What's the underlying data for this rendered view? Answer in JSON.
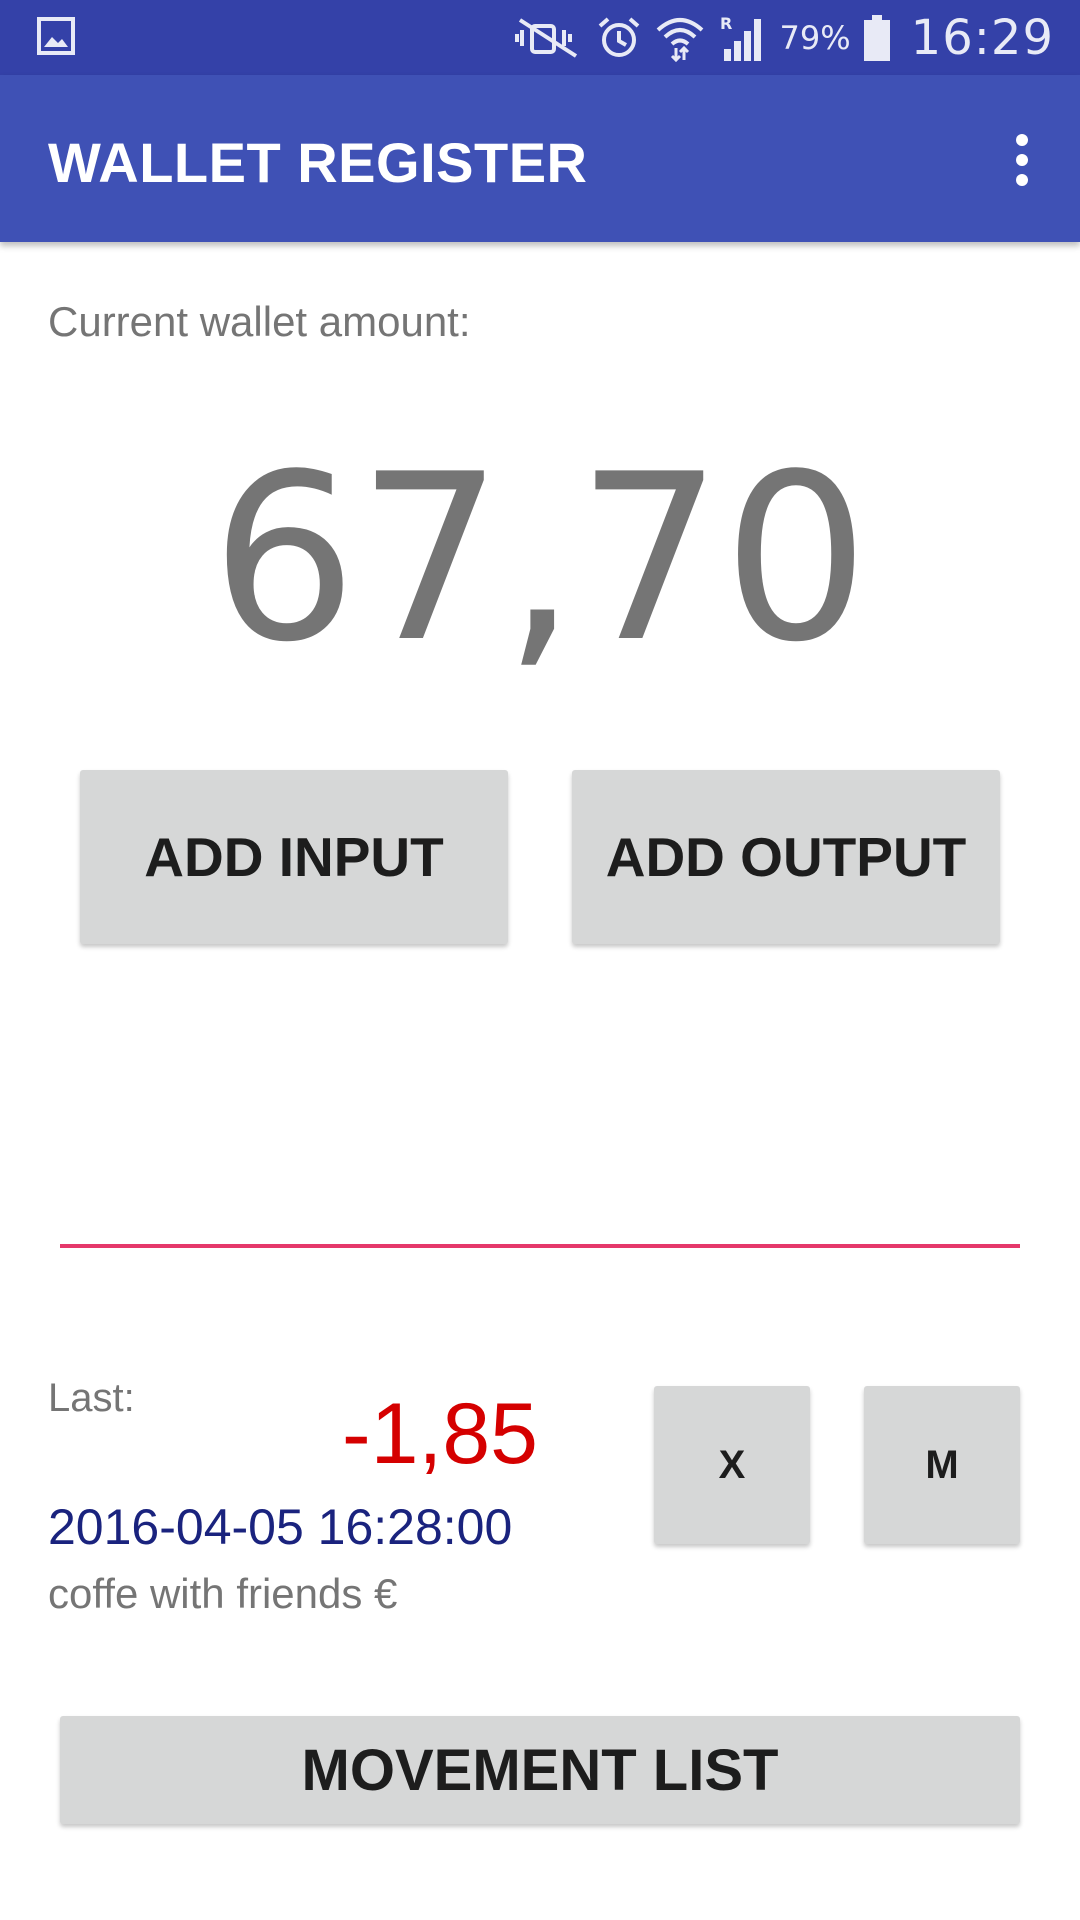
{
  "status_bar": {
    "battery_percent": "79%",
    "time": "16:29",
    "icons": [
      "gallery-icon",
      "mute-vibrate-icon",
      "alarm-icon",
      "wifi-icon",
      "signal-roaming-icon",
      "battery-icon"
    ]
  },
  "app_bar": {
    "title": "WALLET REGISTER",
    "overflow_icon": "more-vert-icon"
  },
  "wallet": {
    "label": "Current wallet amount:",
    "amount": "67,70"
  },
  "actions": {
    "add_input_label": "ADD INPUT",
    "add_output_label": "ADD OUTPUT"
  },
  "last_movement": {
    "label": "Last:",
    "value": "-1,85",
    "datetime": "2016-04-05 16:28:00",
    "description": "coffe with friends €",
    "delete_label": "X",
    "modify_label": "M"
  },
  "footer": {
    "movement_list_label": "MOVEMENT LIST"
  },
  "colors": {
    "status_bar": "#3441a8",
    "app_bar": "#3f51b5",
    "negative_amount": "#d50000",
    "date_text": "#1a237e",
    "divider": "#e5386b",
    "button_bg": "#d6d7d7"
  }
}
